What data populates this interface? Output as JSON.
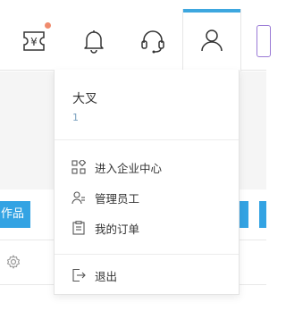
{
  "header": {
    "icons": [
      "coupon-icon",
      "bell-icon",
      "headset-icon",
      "user-icon"
    ],
    "accent": "#3da7df",
    "badge_color": "#f08b6d"
  },
  "background": {
    "tab_left_label": "作品",
    "accent": "#33a3e3"
  },
  "dropdown": {
    "user_name": "大叉",
    "user_id": "1",
    "items": [
      {
        "label": "进入企业中心",
        "icon": "grid-icon"
      },
      {
        "label": "管理员工",
        "icon": "staff-icon"
      },
      {
        "label": "我的订单",
        "icon": "clipboard-icon"
      }
    ],
    "logout": {
      "label": "退出",
      "icon": "logout-icon"
    }
  }
}
